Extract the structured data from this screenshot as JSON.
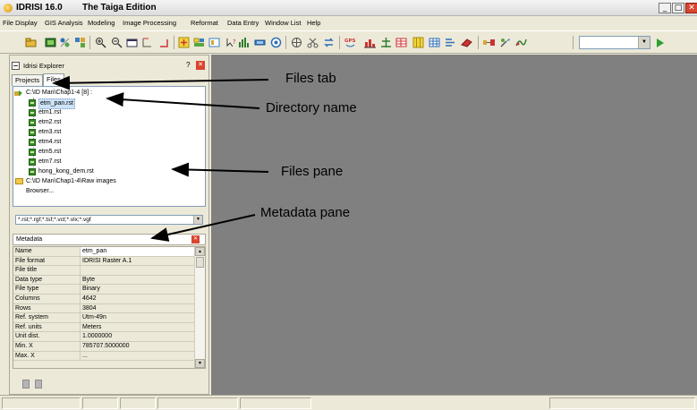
{
  "window": {
    "title": "IDRISI 16.0",
    "subtitle": "The Taiga Edition",
    "controls": [
      "minimize",
      "maximize",
      "close"
    ]
  },
  "menu": [
    "File",
    "Display",
    "GIS Analysis",
    "Modeling",
    "Image Processing",
    "Reformat",
    "Data Entry",
    "Window List",
    "Help"
  ],
  "toolbar": {
    "icons": [
      "open-folder-icon",
      "display-icon",
      "composer-icon",
      "symbol-icon",
      "zoom-in-icon",
      "zoom-out-icon",
      "window-icon",
      "query-icon",
      "measure-icon",
      "layer-add-icon",
      "layer-icon",
      "view-icon",
      "help-cursor-icon",
      "histogram-icon",
      "palette-icon",
      "settings-icon",
      "digitize-icon",
      "scissors-icon",
      "flip-icon",
      "gps-icon",
      "chart-icon",
      "scale-icon",
      "table-icon",
      "grid-icon",
      "database-icon",
      "list-icon",
      "eraser-icon",
      "pipeline-icon",
      "brush-icon",
      "curve-icon"
    ],
    "combo_value": "",
    "run_icon": "play-icon"
  },
  "explorer": {
    "title": "Idrisi Explorer",
    "help": "?",
    "tabs": [
      {
        "label": "Projects",
        "active": false
      },
      {
        "label": "Files",
        "active": true
      }
    ],
    "files": {
      "directory": "C:\\ID Man\\Chap1-4 [8] :",
      "items": [
        "etm_pan.rst",
        "etm1.rst",
        "etm2.rst",
        "etm3.rst",
        "etm4.rst",
        "etm5.rst",
        "etm7.rst",
        "hong_kong_dem.rst"
      ],
      "selected_index": 0,
      "other_directory": "C:\\ID Man\\Chap1-4\\Raw images",
      "browser": "Browser..."
    },
    "filter": "*.rst;*.rgf;*.tsf;*.vct;*.vlx;*.vgf"
  },
  "metadata": {
    "title": "Metadata",
    "rows": [
      {
        "key": "Name",
        "value": "etm_pan"
      },
      {
        "key": "File format",
        "value": "IDRISI Raster A.1"
      },
      {
        "key": "File title",
        "value": ""
      },
      {
        "key": "Data type",
        "value": "Byte"
      },
      {
        "key": "File type",
        "value": "Binary"
      },
      {
        "key": "Columns",
        "value": "4642"
      },
      {
        "key": "Rows",
        "value": "3804"
      },
      {
        "key": "Ref. system",
        "value": "Utm-49n"
      },
      {
        "key": "Ref. units",
        "value": "Meters"
      },
      {
        "key": "Unit dist.",
        "value": "1.0000000"
      },
      {
        "key": "Min. X",
        "value": "785707.5000000"
      },
      {
        "key": "Max. X",
        "value": "..."
      }
    ]
  },
  "annotations": {
    "files_tab": "Files tab",
    "directory_name": "Directory name",
    "files_pane": "Files pane",
    "metadata_pane": "Metadata pane"
  },
  "colors": {
    "workspace": "#808080",
    "chrome": "#ece9d8",
    "close_red": "#d9452e",
    "run_green": "#2e9e2e"
  }
}
